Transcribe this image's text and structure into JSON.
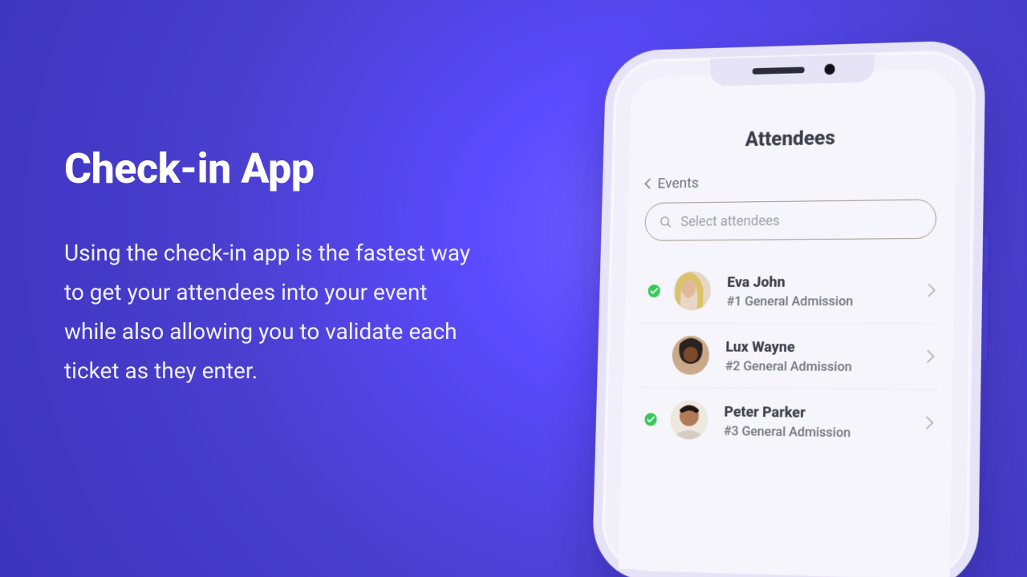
{
  "marketing": {
    "title": "Check-in App",
    "body": "Using the check-in app is the fastest way to get your attendees into your event while also allowing you to validate each ticket as they enter."
  },
  "phone": {
    "screen_title": "Attendees",
    "back_label": "Events",
    "search": {
      "placeholder": "Select attendees"
    },
    "attendees": [
      {
        "name": "Eva John",
        "ticket": "#1 General Admission",
        "checked": true
      },
      {
        "name": "Lux Wayne",
        "ticket": "#2 General Admission",
        "checked": false
      },
      {
        "name": "Peter Parker",
        "ticket": "#3 General Admission",
        "checked": true
      }
    ]
  },
  "colors": {
    "accent": "#4f45e3",
    "check_green": "#34c759"
  }
}
